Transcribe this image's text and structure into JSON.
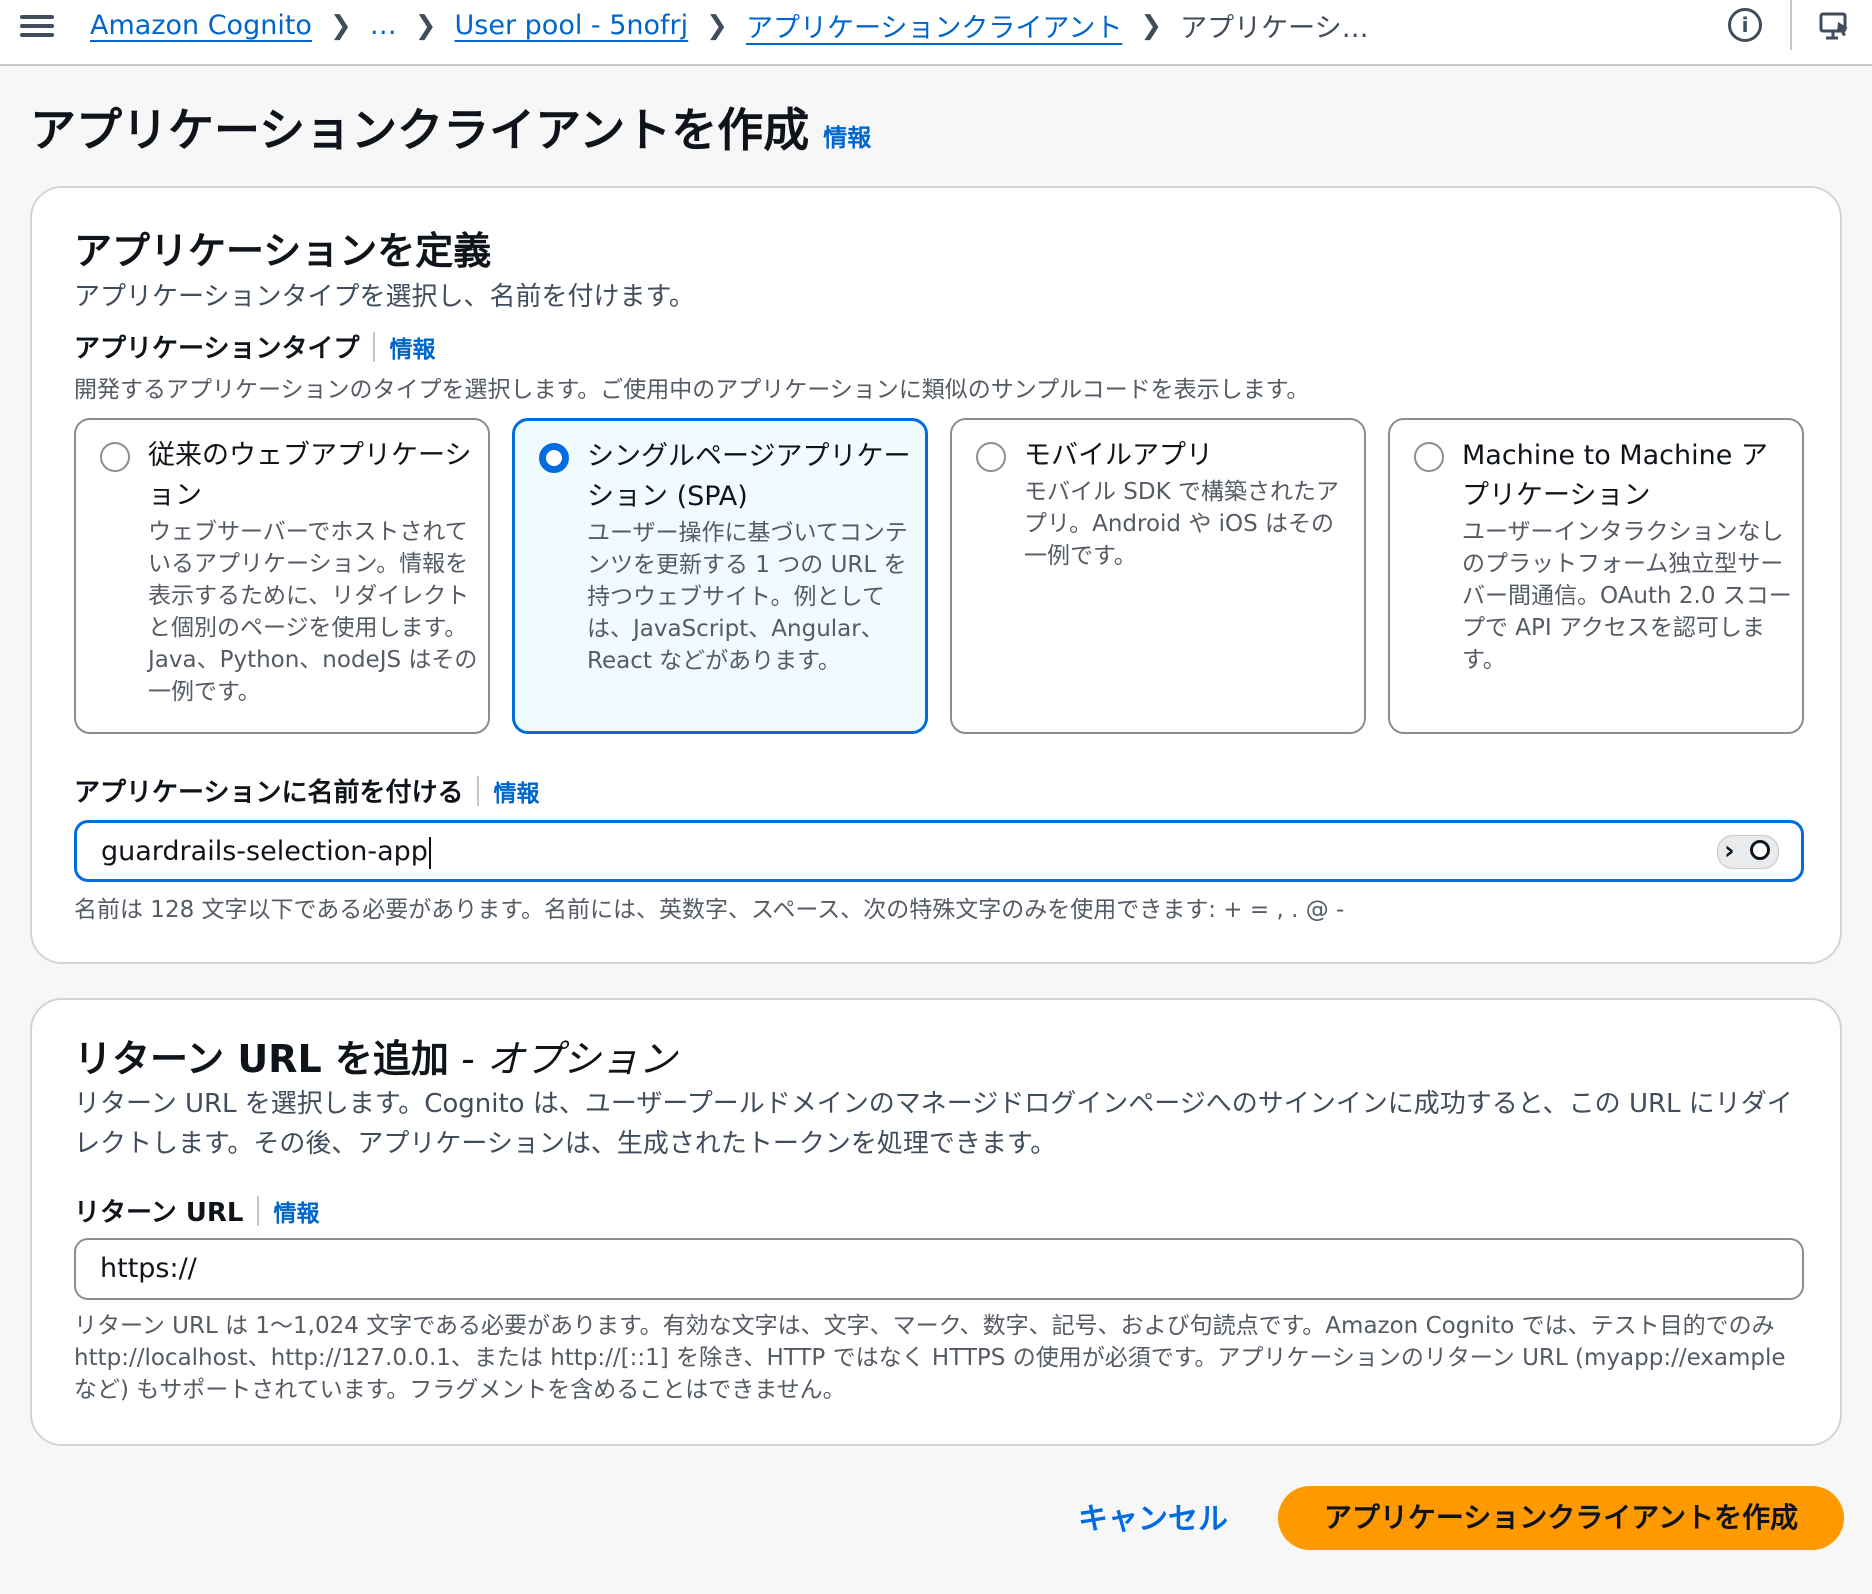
{
  "breadcrumb": {
    "items": [
      "Amazon Cognito",
      "…",
      "User pool - 5nofrj",
      "アプリケーションクライアント"
    ],
    "current": "アプリケーシ…"
  },
  "page": {
    "title": "アプリケーションクライアントを作成",
    "info": "情報"
  },
  "define": {
    "heading": "アプリケーションを定義",
    "description": "アプリケーションタイプを選択し、名前を付けます。",
    "type_label": "アプリケーションタイプ",
    "type_info": "情報",
    "type_hint": "開発するアプリケーションのタイプを選択します。ご使用中のアプリケーションに類似のサンプルコードを表示します。",
    "tiles": [
      {
        "title": "従来のウェブアプリケーション",
        "desc": "ウェブサーバーでホストされているアプリケーション。情報を表示するために、リダイレクトと個別のページを使用します。Java、Python、nodeJS はその一例です。",
        "selected": false
      },
      {
        "title": "シングルページアプリケーション (SPA)",
        "desc": "ユーザー操作に基づいてコンテンツを更新する 1 つの URL を持つウェブサイト。例としては、JavaScript、Angular、React などがあります。",
        "selected": true
      },
      {
        "title": "モバイルアプリ",
        "desc": "モバイル SDK で構築されたアプリ。Android や iOS はその一例です。",
        "selected": false
      },
      {
        "title": "Machine to Machine アプリケーション",
        "desc": "ユーザーインタラクションなしのプラットフォーム独立型サーバー間通信。OAuth 2.0 スコープで API アクセスを認可します。",
        "selected": false
      }
    ],
    "name_label": "アプリケーションに名前を付ける",
    "name_info": "情報",
    "name_value": "guardrails-selection-app",
    "name_hint": "名前は 128 文字以下である必要があります。名前には、英数字、スペース、次の特殊文字のみを使用できます: + = , . @ -"
  },
  "return_url": {
    "heading": "リターン URL を追加",
    "heading_optional": " - オプション",
    "description": "リターン URL を選択します。Cognito は、ユーザープールドメインのマネージドログインページへのサインインに成功すると、この URL にリダイレクトします。その後、アプリケーションは、生成されたトークンを処理できます。",
    "label": "リターン URL",
    "info": "情報",
    "value": "https://",
    "hint": "リターン URL は 1～1,024 文字である必要があります。有効な文字は、文字、マーク、数字、記号、および句読点です。Amazon Cognito では、テスト目的でのみ http://localhost、http://127.0.0.1、または http://[::1] を除き、HTTP ではなく HTTPS の使用が必須です。アプリケーションのリターン URL (myapp://example など) もサポートされています。フラグメントを含めることはできません。"
  },
  "footer": {
    "cancel": "キャンセル",
    "create": "アプリケーションクライアントを作成"
  },
  "colors": {
    "accent": "#006ce0",
    "primary_button": "#ff9900"
  },
  "icons": [
    "menu-icon",
    "chevron-right-icon",
    "info-icon",
    "monitor-icon"
  ]
}
